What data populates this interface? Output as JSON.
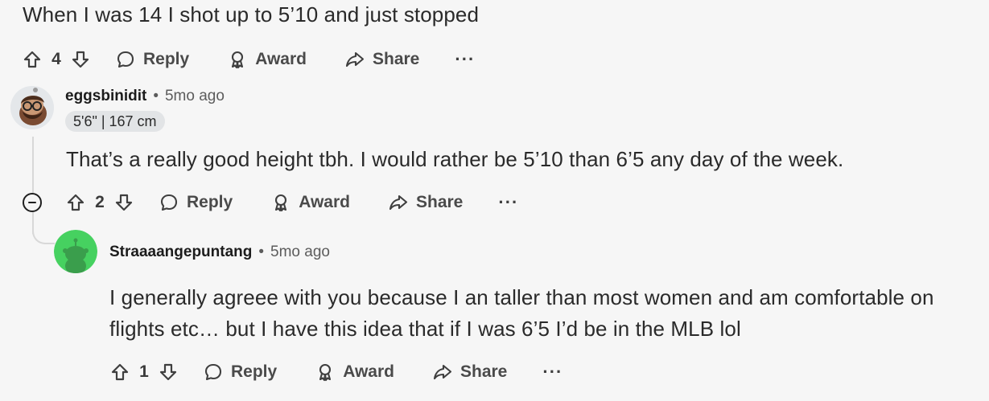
{
  "top_comment": {
    "text": "When I was 14 I shot up to 5’10 and just stopped",
    "votes": "4",
    "actions": {
      "reply": "Reply",
      "award": "Award",
      "share": "Share",
      "more": "···"
    }
  },
  "reply_1": {
    "username": "eggsbinidit",
    "separator": "•",
    "time": "5mo ago",
    "flair": "5'6\" | 167 cm",
    "text": "That’s a really good height tbh. I would rather be 5’10 than 6’5 any day of the week.",
    "votes": "2",
    "actions": {
      "reply": "Reply",
      "award": "Award",
      "share": "Share",
      "more": "···"
    }
  },
  "reply_2": {
    "username": "Straaaangepuntang",
    "separator": "•",
    "time": "5mo ago",
    "text_line_1": "I generally agreee with you because I an taller than most women and am comfortable on",
    "text_line_2": "flights etc… but I have this idea that if I was 6’5 I’d be in the MLB lol",
    "votes": "1",
    "actions": {
      "reply": "Reply",
      "award": "Award",
      "share": "Share",
      "more": "···"
    }
  },
  "colors": {
    "background": "#f6f6f6",
    "text": "#1f1f1f",
    "muted": "#5c5c5c",
    "flair_bg": "#e2e4e6",
    "avatar_green": "#46d160"
  }
}
